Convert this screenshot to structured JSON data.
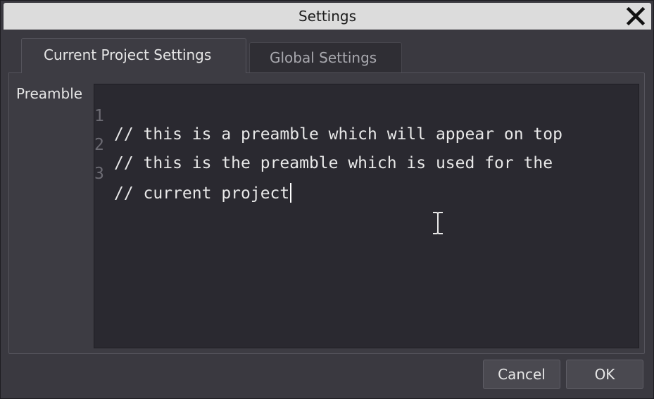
{
  "window": {
    "title": "Settings",
    "close_icon": "close-icon"
  },
  "tabs": [
    {
      "label": "Current Project Settings",
      "active": true
    },
    {
      "label": "Global Settings",
      "active": false
    }
  ],
  "preamble": {
    "label": "Preamble",
    "lines": [
      {
        "number": "1",
        "text": "// this is a preamble which will appear on top"
      },
      {
        "number": "2",
        "text": "// this is the preamble which is used for the"
      },
      {
        "number": "3",
        "text": "// current project"
      }
    ]
  },
  "buttons": {
    "cancel": "Cancel",
    "ok": "OK"
  },
  "colors": {
    "titlebar": "#dcdcdc",
    "window_bg": "#3a3940",
    "editor_bg": "#2a2930",
    "text": "#e6e6e6",
    "line_number": "#6c6b73"
  }
}
